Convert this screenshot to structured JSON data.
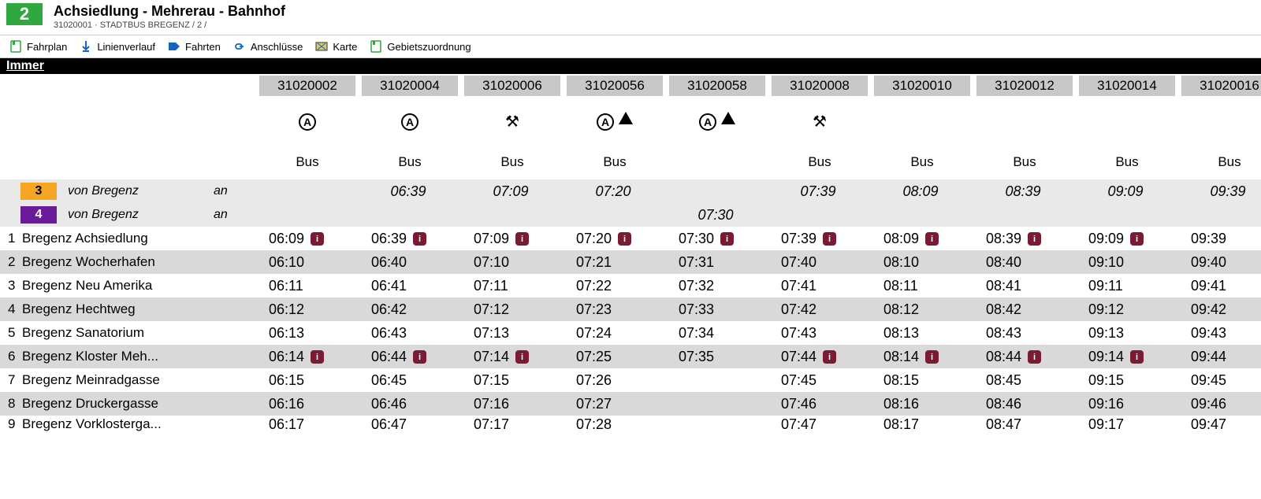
{
  "header": {
    "line_number": "2",
    "title": "Achsiedlung - Mehrerau - Bahnhof",
    "sub": "31020001 ·   STADTBUS BREGENZ /  2 /"
  },
  "toolbar": {
    "fahrplan": "Fahrplan",
    "linienverlauf": "Linienverlauf",
    "fahrten": "Fahrten",
    "anschluesse": "Anschlüsse",
    "karte": "Karte",
    "gebietszuordnung": "Gebietszuordnung"
  },
  "section_label": "Immer",
  "trips": [
    {
      "id": "31020002",
      "symbols": "A",
      "vehicle": "Bus"
    },
    {
      "id": "31020004",
      "symbols": "A",
      "vehicle": "Bus"
    },
    {
      "id": "31020006",
      "symbols": "X",
      "vehicle": "Bus"
    },
    {
      "id": "31020056",
      "symbols": "AT",
      "vehicle": "Bus"
    },
    {
      "id": "31020058",
      "symbols": "AT",
      "vehicle": ""
    },
    {
      "id": "31020008",
      "symbols": "X",
      "vehicle": "Bus"
    },
    {
      "id": "31020010",
      "symbols": "",
      "vehicle": "Bus"
    },
    {
      "id": "31020012",
      "symbols": "",
      "vehicle": "Bus"
    },
    {
      "id": "31020014",
      "symbols": "",
      "vehicle": "Bus"
    },
    {
      "id": "31020016",
      "symbols": "",
      "vehicle": "Bus"
    }
  ],
  "connections": [
    {
      "badge": "3",
      "cls": "badge-3",
      "text": "von Bregenz",
      "an": "an",
      "times": [
        "",
        "06:39",
        "07:09",
        "07:20",
        "",
        "07:39",
        "08:09",
        "08:39",
        "09:09",
        "09:39"
      ]
    },
    {
      "badge": "4",
      "cls": "badge-4",
      "text": "von Bregenz",
      "an": "an",
      "times": [
        "",
        "",
        "",
        "",
        "07:30",
        "",
        "",
        "",
        "",
        ""
      ]
    }
  ],
  "stops": [
    {
      "n": "1",
      "name": "Bregenz Achsiedlung",
      "times": [
        [
          "06:09",
          true
        ],
        [
          "06:39",
          true
        ],
        [
          "07:09",
          true
        ],
        [
          "07:20",
          true
        ],
        [
          "07:30",
          true
        ],
        [
          "07:39",
          true
        ],
        [
          "08:09",
          true
        ],
        [
          "08:39",
          true
        ],
        [
          "09:09",
          true
        ],
        [
          "09:39",
          false
        ]
      ]
    },
    {
      "n": "2",
      "name": "Bregenz Wocherhafen",
      "alt": true,
      "times": [
        [
          "06:10",
          false
        ],
        [
          "06:40",
          false
        ],
        [
          "07:10",
          false
        ],
        [
          "07:21",
          false
        ],
        [
          "07:31",
          false
        ],
        [
          "07:40",
          false
        ],
        [
          "08:10",
          false
        ],
        [
          "08:40",
          false
        ],
        [
          "09:10",
          false
        ],
        [
          "09:40",
          false
        ]
      ]
    },
    {
      "n": "3",
      "name": "Bregenz Neu Amerika",
      "times": [
        [
          "06:11",
          false
        ],
        [
          "06:41",
          false
        ],
        [
          "07:11",
          false
        ],
        [
          "07:22",
          false
        ],
        [
          "07:32",
          false
        ],
        [
          "07:41",
          false
        ],
        [
          "08:11",
          false
        ],
        [
          "08:41",
          false
        ],
        [
          "09:11",
          false
        ],
        [
          "09:41",
          false
        ]
      ]
    },
    {
      "n": "4",
      "name": "Bregenz Hechtweg",
      "alt": true,
      "times": [
        [
          "06:12",
          false
        ],
        [
          "06:42",
          false
        ],
        [
          "07:12",
          false
        ],
        [
          "07:23",
          false
        ],
        [
          "07:33",
          false
        ],
        [
          "07:42",
          false
        ],
        [
          "08:12",
          false
        ],
        [
          "08:42",
          false
        ],
        [
          "09:12",
          false
        ],
        [
          "09:42",
          false
        ]
      ]
    },
    {
      "n": "5",
      "name": "Bregenz Sanatorium",
      "times": [
        [
          "06:13",
          false
        ],
        [
          "06:43",
          false
        ],
        [
          "07:13",
          false
        ],
        [
          "07:24",
          false
        ],
        [
          "07:34",
          false
        ],
        [
          "07:43",
          false
        ],
        [
          "08:13",
          false
        ],
        [
          "08:43",
          false
        ],
        [
          "09:13",
          false
        ],
        [
          "09:43",
          false
        ]
      ]
    },
    {
      "n": "6",
      "name": "Bregenz Kloster Meh...",
      "alt": true,
      "times": [
        [
          "06:14",
          true
        ],
        [
          "06:44",
          true
        ],
        [
          "07:14",
          true
        ],
        [
          "07:25",
          false
        ],
        [
          "07:35",
          false
        ],
        [
          "07:44",
          true
        ],
        [
          "08:14",
          true
        ],
        [
          "08:44",
          true
        ],
        [
          "09:14",
          true
        ],
        [
          "09:44",
          false
        ]
      ]
    },
    {
      "n": "7",
      "name": "Bregenz Meinradgasse",
      "times": [
        [
          "06:15",
          false
        ],
        [
          "06:45",
          false
        ],
        [
          "07:15",
          false
        ],
        [
          "07:26",
          false
        ],
        [
          "",
          false
        ],
        [
          "07:45",
          false
        ],
        [
          "08:15",
          false
        ],
        [
          "08:45",
          false
        ],
        [
          "09:15",
          false
        ],
        [
          "09:45",
          false
        ]
      ]
    },
    {
      "n": "8",
      "name": "Bregenz Druckergasse",
      "alt": true,
      "times": [
        [
          "06:16",
          false
        ],
        [
          "06:46",
          false
        ],
        [
          "07:16",
          false
        ],
        [
          "07:27",
          false
        ],
        [
          "",
          false
        ],
        [
          "07:46",
          false
        ],
        [
          "08:16",
          false
        ],
        [
          "08:46",
          false
        ],
        [
          "09:16",
          false
        ],
        [
          "09:46",
          false
        ]
      ]
    },
    {
      "n": "9",
      "name": "Bregenz Vorklosterga...",
      "last": true,
      "times": [
        [
          "06:17",
          false
        ],
        [
          "06:47",
          false
        ],
        [
          "07:17",
          false
        ],
        [
          "07:28",
          false
        ],
        [
          "",
          false
        ],
        [
          "07:47",
          false
        ],
        [
          "08:17",
          false
        ],
        [
          "08:47",
          false
        ],
        [
          "09:17",
          false
        ],
        [
          "09:47",
          false
        ]
      ]
    }
  ]
}
